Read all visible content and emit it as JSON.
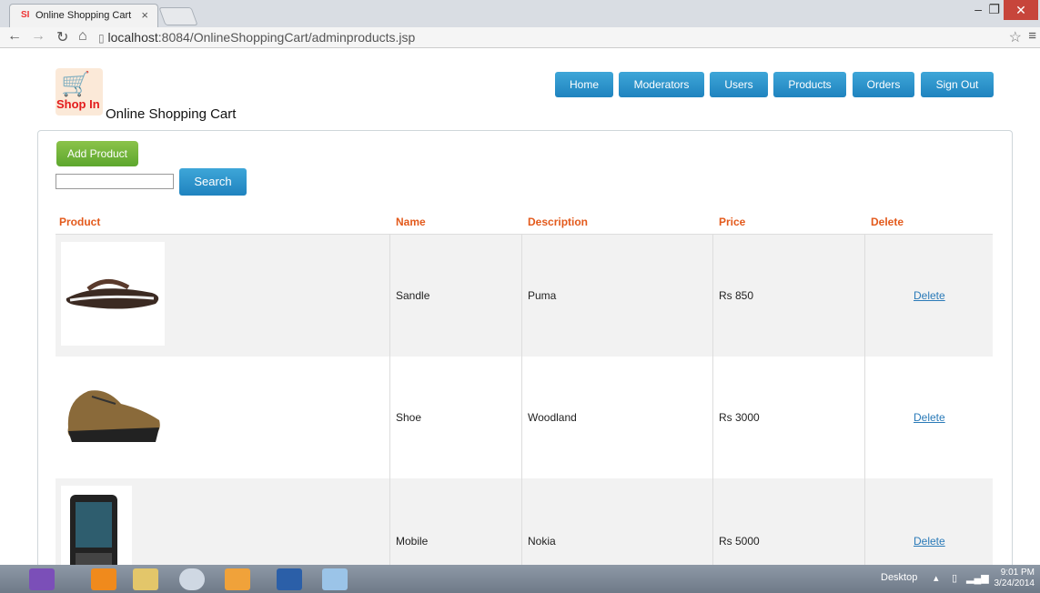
{
  "browser": {
    "tab_title": "Online Shopping Cart",
    "tab_close": "×",
    "url_host": "localhost",
    "url_rest": ":8084/OnlineShoppingCart/adminproducts.jsp"
  },
  "site": {
    "logo_text": "Shop In",
    "title": "Online Shopping Cart"
  },
  "nav": [
    "Home",
    "Moderators",
    "Users",
    "Products",
    "Orders",
    "Sign Out"
  ],
  "actions": {
    "add_label": "Add Product",
    "search_label": "Search",
    "search_value": ""
  },
  "table": {
    "headers": [
      "Product",
      "Name",
      "Description",
      "Price",
      "Delete"
    ],
    "rows": [
      {
        "image": "sandal-image",
        "name": "Sandle",
        "description": "Puma",
        "price": "Rs 850",
        "action": "Delete"
      },
      {
        "image": "shoe-image",
        "name": "Shoe",
        "description": "Woodland",
        "price": "Rs 3000",
        "action": "Delete"
      },
      {
        "image": "mobile-image",
        "name": "Mobile",
        "description": "Nokia",
        "price": "Rs 5000",
        "action": "Delete"
      }
    ]
  },
  "taskbar": {
    "desktop_label": "Desktop",
    "time": "9:01 PM",
    "date": "3/24/2014"
  }
}
